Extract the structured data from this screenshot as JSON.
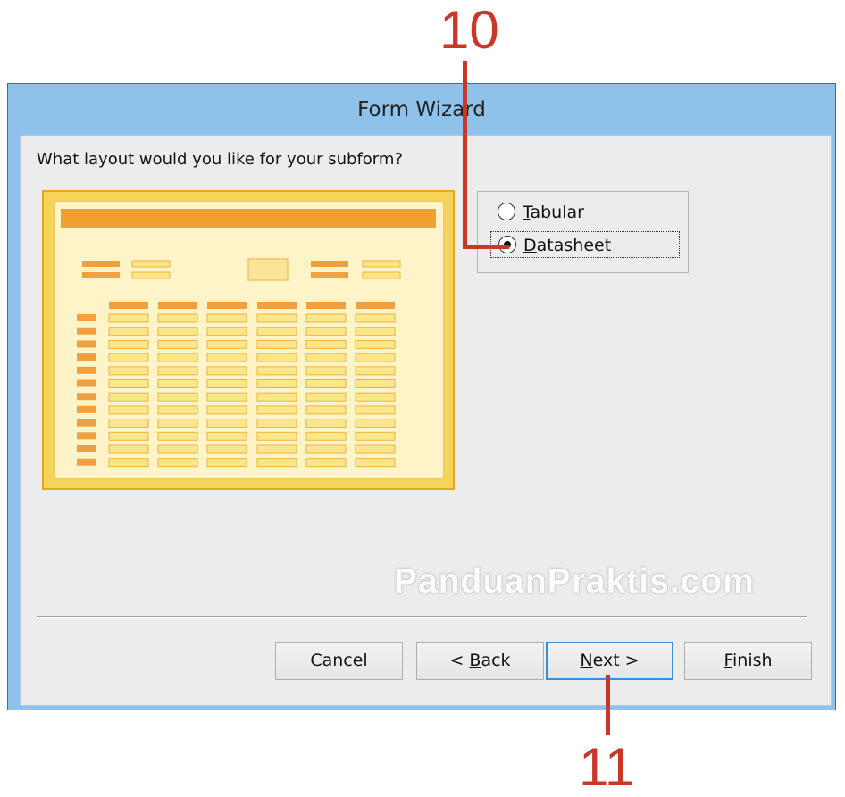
{
  "callouts": {
    "step_top": "10",
    "step_bottom": "11"
  },
  "window": {
    "title": "Form Wizard"
  },
  "wizard": {
    "question": "What layout would you like for your subform?",
    "options": [
      {
        "label": "Tabular",
        "mnemonic": "T",
        "rest": "abular",
        "selected": false
      },
      {
        "label": "Datasheet",
        "mnemonic": "D",
        "rest": "atasheet",
        "selected": true
      }
    ]
  },
  "watermark": "PanduanPraktis.com",
  "buttons": {
    "cancel": {
      "label": "Cancel"
    },
    "back": {
      "prefix": "< ",
      "mnemonic": "B",
      "rest": "ack"
    },
    "next": {
      "mnemonic": "N",
      "rest": "ext >"
    },
    "finish": {
      "mnemonic": "F",
      "rest": "inish"
    }
  },
  "colors": {
    "callout": "#c9362a",
    "window_frame": "#8fc2ea",
    "preview_gold": "#f6d45a",
    "preview_orange": "#f0a040",
    "default_button_border": "#3c8fd6"
  }
}
